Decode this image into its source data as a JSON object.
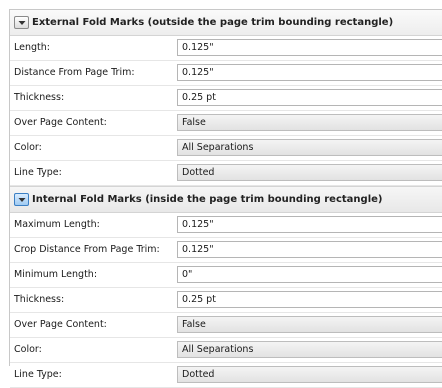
{
  "sections": [
    {
      "title": "External Fold Marks (outside the page trim bounding rectangle)",
      "toggle_icon": "chevron-down-icon",
      "rows": [
        {
          "label": "Length:",
          "value": "0.125\"",
          "kind": "input"
        },
        {
          "label": "Distance From Page Trim:",
          "value": "0.125\"",
          "kind": "input"
        },
        {
          "label": "Thickness:",
          "value": "0.25 pt",
          "kind": "input"
        },
        {
          "label": "Over Page Content:",
          "value": "False",
          "kind": "select"
        },
        {
          "label": "Color:",
          "value": "All Separations",
          "kind": "select"
        },
        {
          "label": "Line Type:",
          "value": "Dotted",
          "kind": "select"
        }
      ]
    },
    {
      "title": "Internal Fold Marks (inside the page trim bounding rectangle)",
      "toggle_icon": "chevron-down-icon",
      "rows": [
        {
          "label": "Maximum Length:",
          "value": "0.125\"",
          "kind": "input"
        },
        {
          "label": "Crop Distance From Page Trim:",
          "value": "0.125\"",
          "kind": "input"
        },
        {
          "label": "Minimum Length:",
          "value": "0\"",
          "kind": "input"
        },
        {
          "label": "Thickness:",
          "value": "0.25 pt",
          "kind": "input"
        },
        {
          "label": "Over Page Content:",
          "value": "False",
          "kind": "select"
        },
        {
          "label": "Color:",
          "value": "All Separations",
          "kind": "select"
        },
        {
          "label": "Line Type:",
          "value": "Dotted",
          "kind": "select"
        }
      ]
    }
  ],
  "colors": {
    "toggle_active": "#9fcaf2",
    "field_border": "#b5b5b5",
    "row_divider": "#e6e6e6"
  }
}
